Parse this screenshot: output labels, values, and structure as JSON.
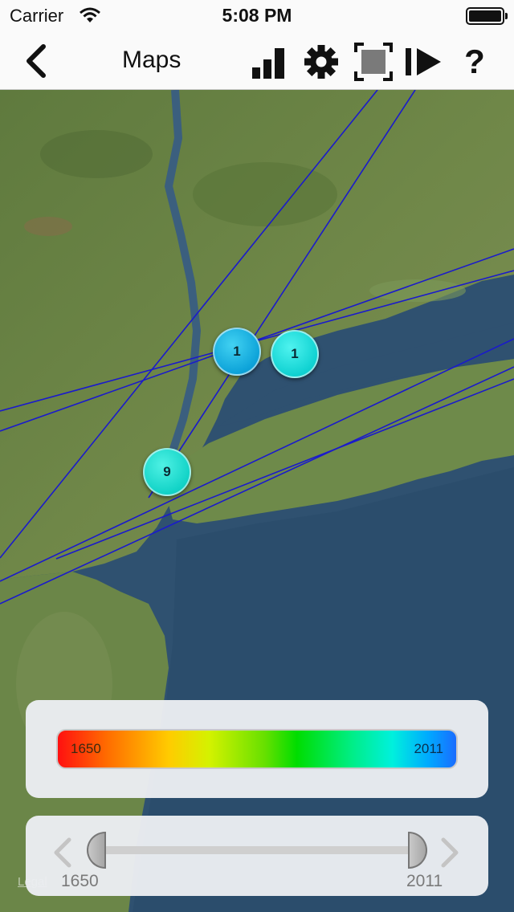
{
  "status_bar": {
    "carrier": "Carrier",
    "time": "5:08 PM"
  },
  "nav": {
    "title": "Maps",
    "icons": [
      "back-chevron-icon",
      "bar-chart-icon",
      "gear-icon",
      "fullscreen-icon",
      "play-step-icon",
      "help-icon"
    ],
    "help_label": "?"
  },
  "map": {
    "clusters": [
      {
        "count": "1",
        "color": "#0da3d9"
      },
      {
        "count": "1",
        "color": "#10d2d2"
      },
      {
        "count": "9",
        "color": "#12d3c7"
      }
    ],
    "legal_label": "Legal",
    "line_color": "#1a1acc"
  },
  "color_scale": {
    "min_label": "1650",
    "max_label": "2011",
    "gradient_colors": [
      "#ff1010",
      "#ffcc00",
      "#00dd00",
      "#00f0dd",
      "#1a6cff"
    ]
  },
  "range_slider": {
    "min_label": "1650",
    "max_label": "2011",
    "selected_from": 1650,
    "selected_to": 2011
  }
}
